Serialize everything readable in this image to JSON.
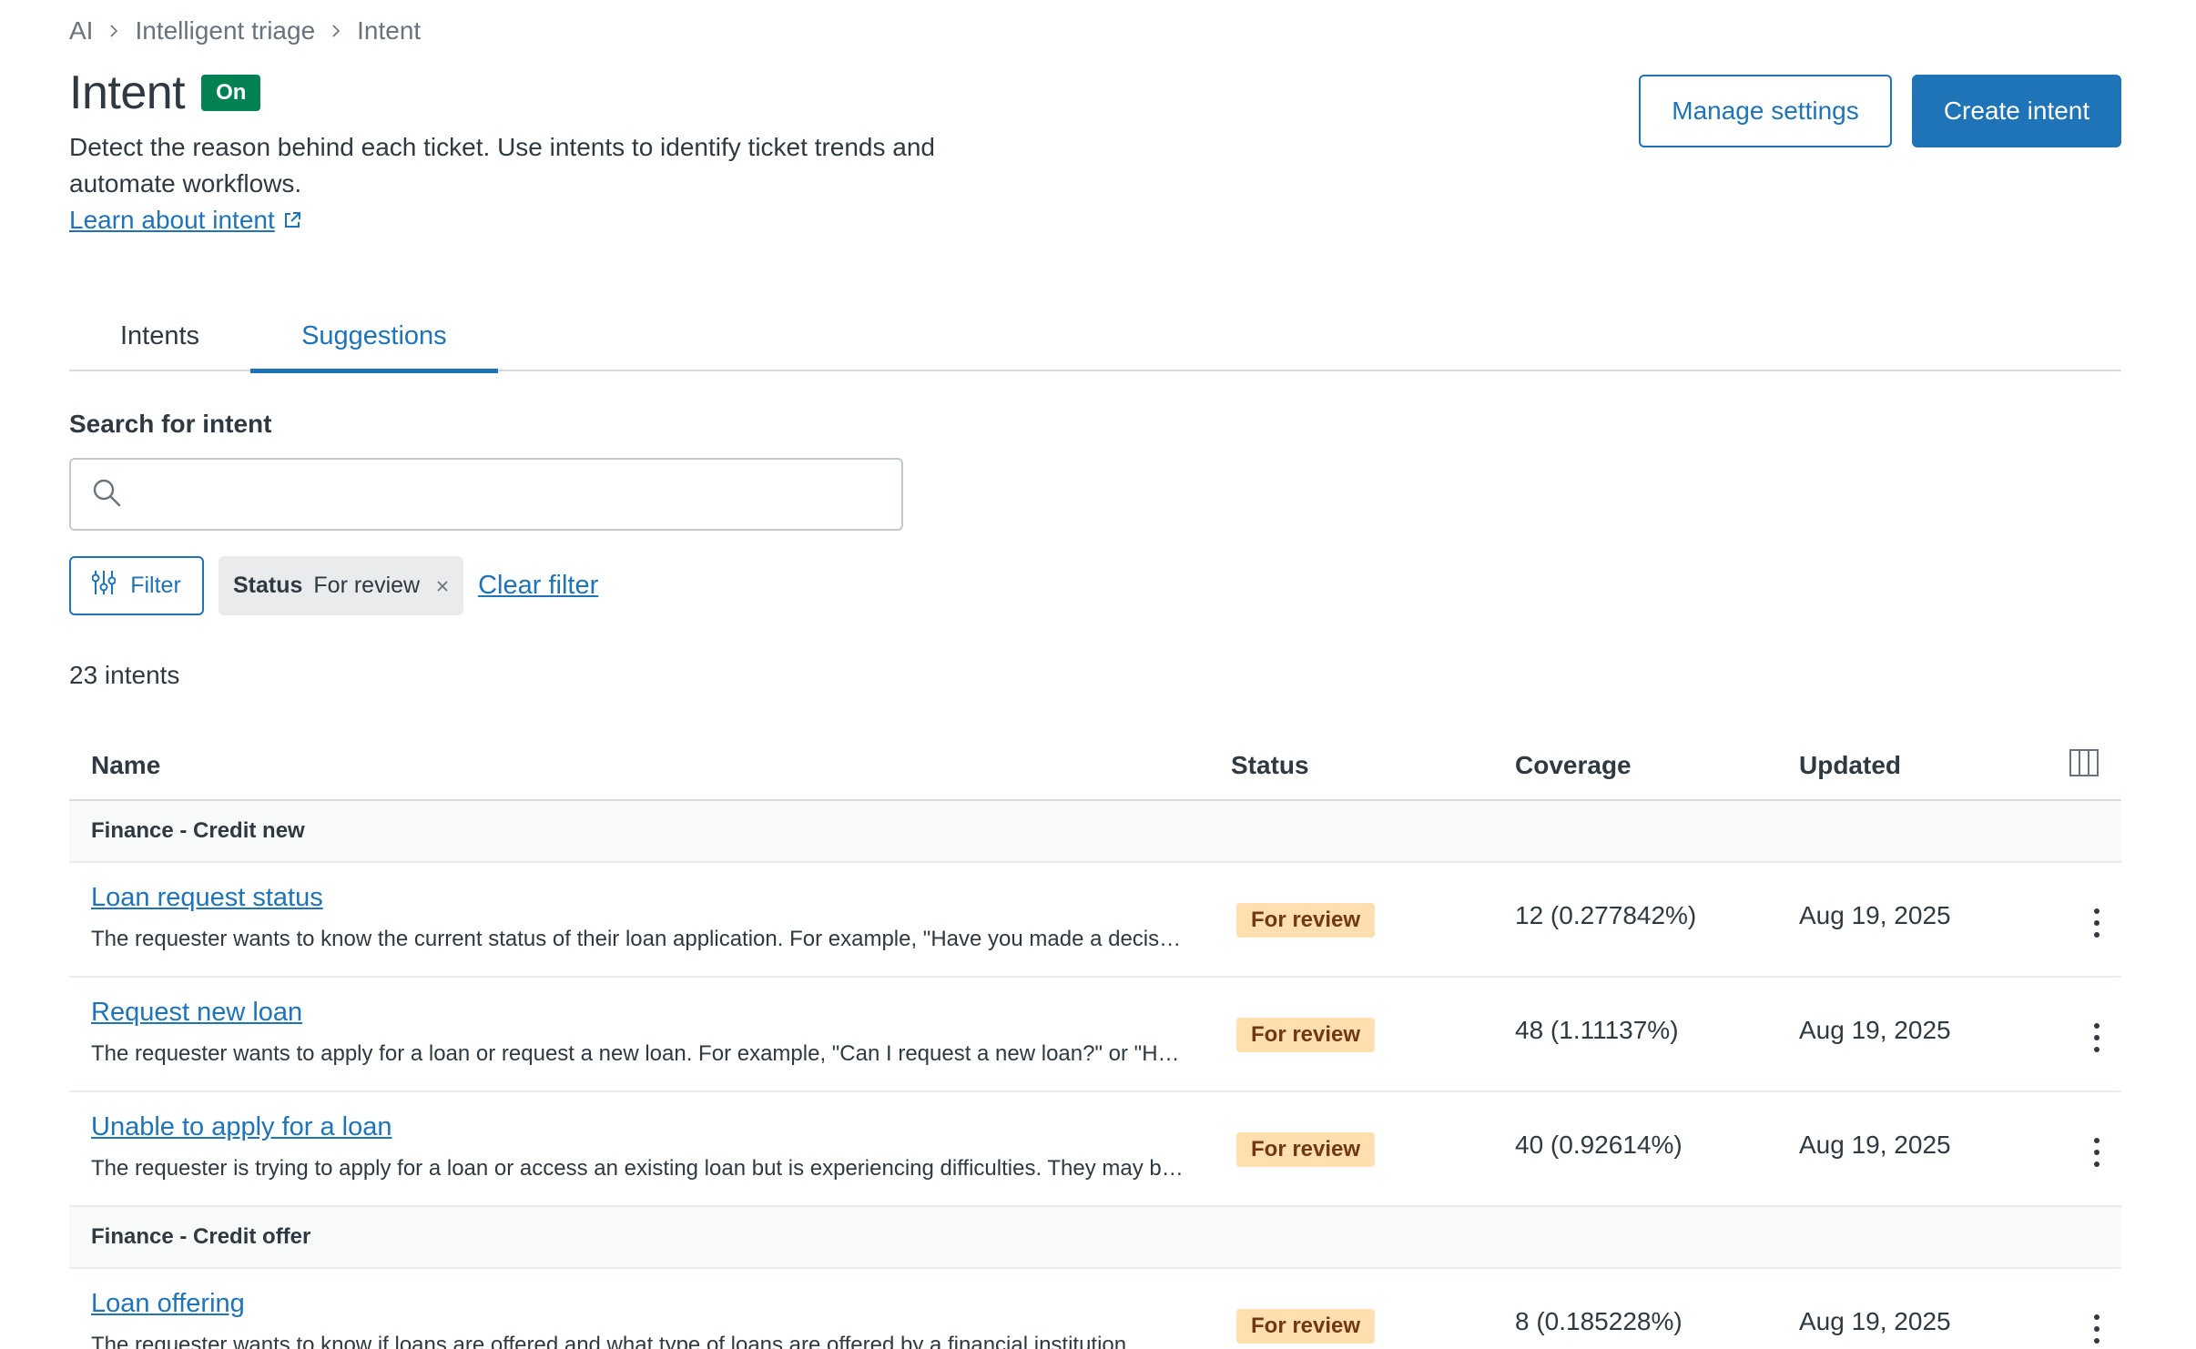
{
  "breadcrumb": {
    "items": [
      "AI",
      "Intelligent triage",
      "Intent"
    ]
  },
  "header": {
    "title": "Intent",
    "badge": "On",
    "description": "Detect the reason behind each ticket. Use intents to identify ticket trends and automate workflows.",
    "learn_link": "Learn about intent",
    "manage_settings": "Manage settings",
    "create_intent": "Create intent"
  },
  "tabs": [
    {
      "label": "Intents",
      "active": false
    },
    {
      "label": "Suggestions",
      "active": true
    }
  ],
  "search": {
    "label": "Search for intent",
    "placeholder": "",
    "value": ""
  },
  "filters": {
    "filter_button": "Filter",
    "chip_key": "Status",
    "chip_value": "For review",
    "clear": "Clear filter"
  },
  "count": "23 intents",
  "table": {
    "columns": {
      "name": "Name",
      "status": "Status",
      "coverage": "Coverage",
      "updated": "Updated"
    },
    "groups": [
      {
        "title": "Finance - Credit new",
        "rows": [
          {
            "name": "Loan request status",
            "desc": "The requester wants to know the current status of their loan application. For example, \"Have you made a decision on my loan application yet?\"",
            "status": "For review",
            "coverage": "12 (0.277842%)",
            "updated": "Aug 19, 2025"
          },
          {
            "name": "Request new loan",
            "desc": "The requester wants to apply for a loan or request a new loan. For example, \"Can I request a new loan?\" or \"How do I apply for a loan?\"",
            "status": "For review",
            "coverage": "48 (1.11137%)",
            "updated": "Aug 19, 2025"
          },
          {
            "name": "Unable to apply for a loan",
            "desc": "The requester is trying to apply for a loan or access an existing loan but is experiencing difficulties. They may be unable to complete the application.",
            "status": "For review",
            "coverage": "40 (0.92614%)",
            "updated": "Aug 19, 2025"
          }
        ]
      },
      {
        "title": "Finance - Credit offer",
        "rows": [
          {
            "name": "Loan offering",
            "desc": "The requester wants to know if loans are offered and what type of loans are offered by a financial institution.",
            "status": "For review",
            "coverage": "8 (0.185228%)",
            "updated": "Aug 19, 2025"
          }
        ]
      }
    ]
  },
  "colors": {
    "accent": "#1f73b7",
    "on_badge": "#038153",
    "review_badge_bg": "#ffdeb0",
    "review_badge_text": "#703815"
  },
  "icons": [
    "chevron-right-icon",
    "external-link-icon",
    "search-icon",
    "filter-sliders-icon",
    "close-icon",
    "columns-icon",
    "kebab-menu-icon"
  ]
}
